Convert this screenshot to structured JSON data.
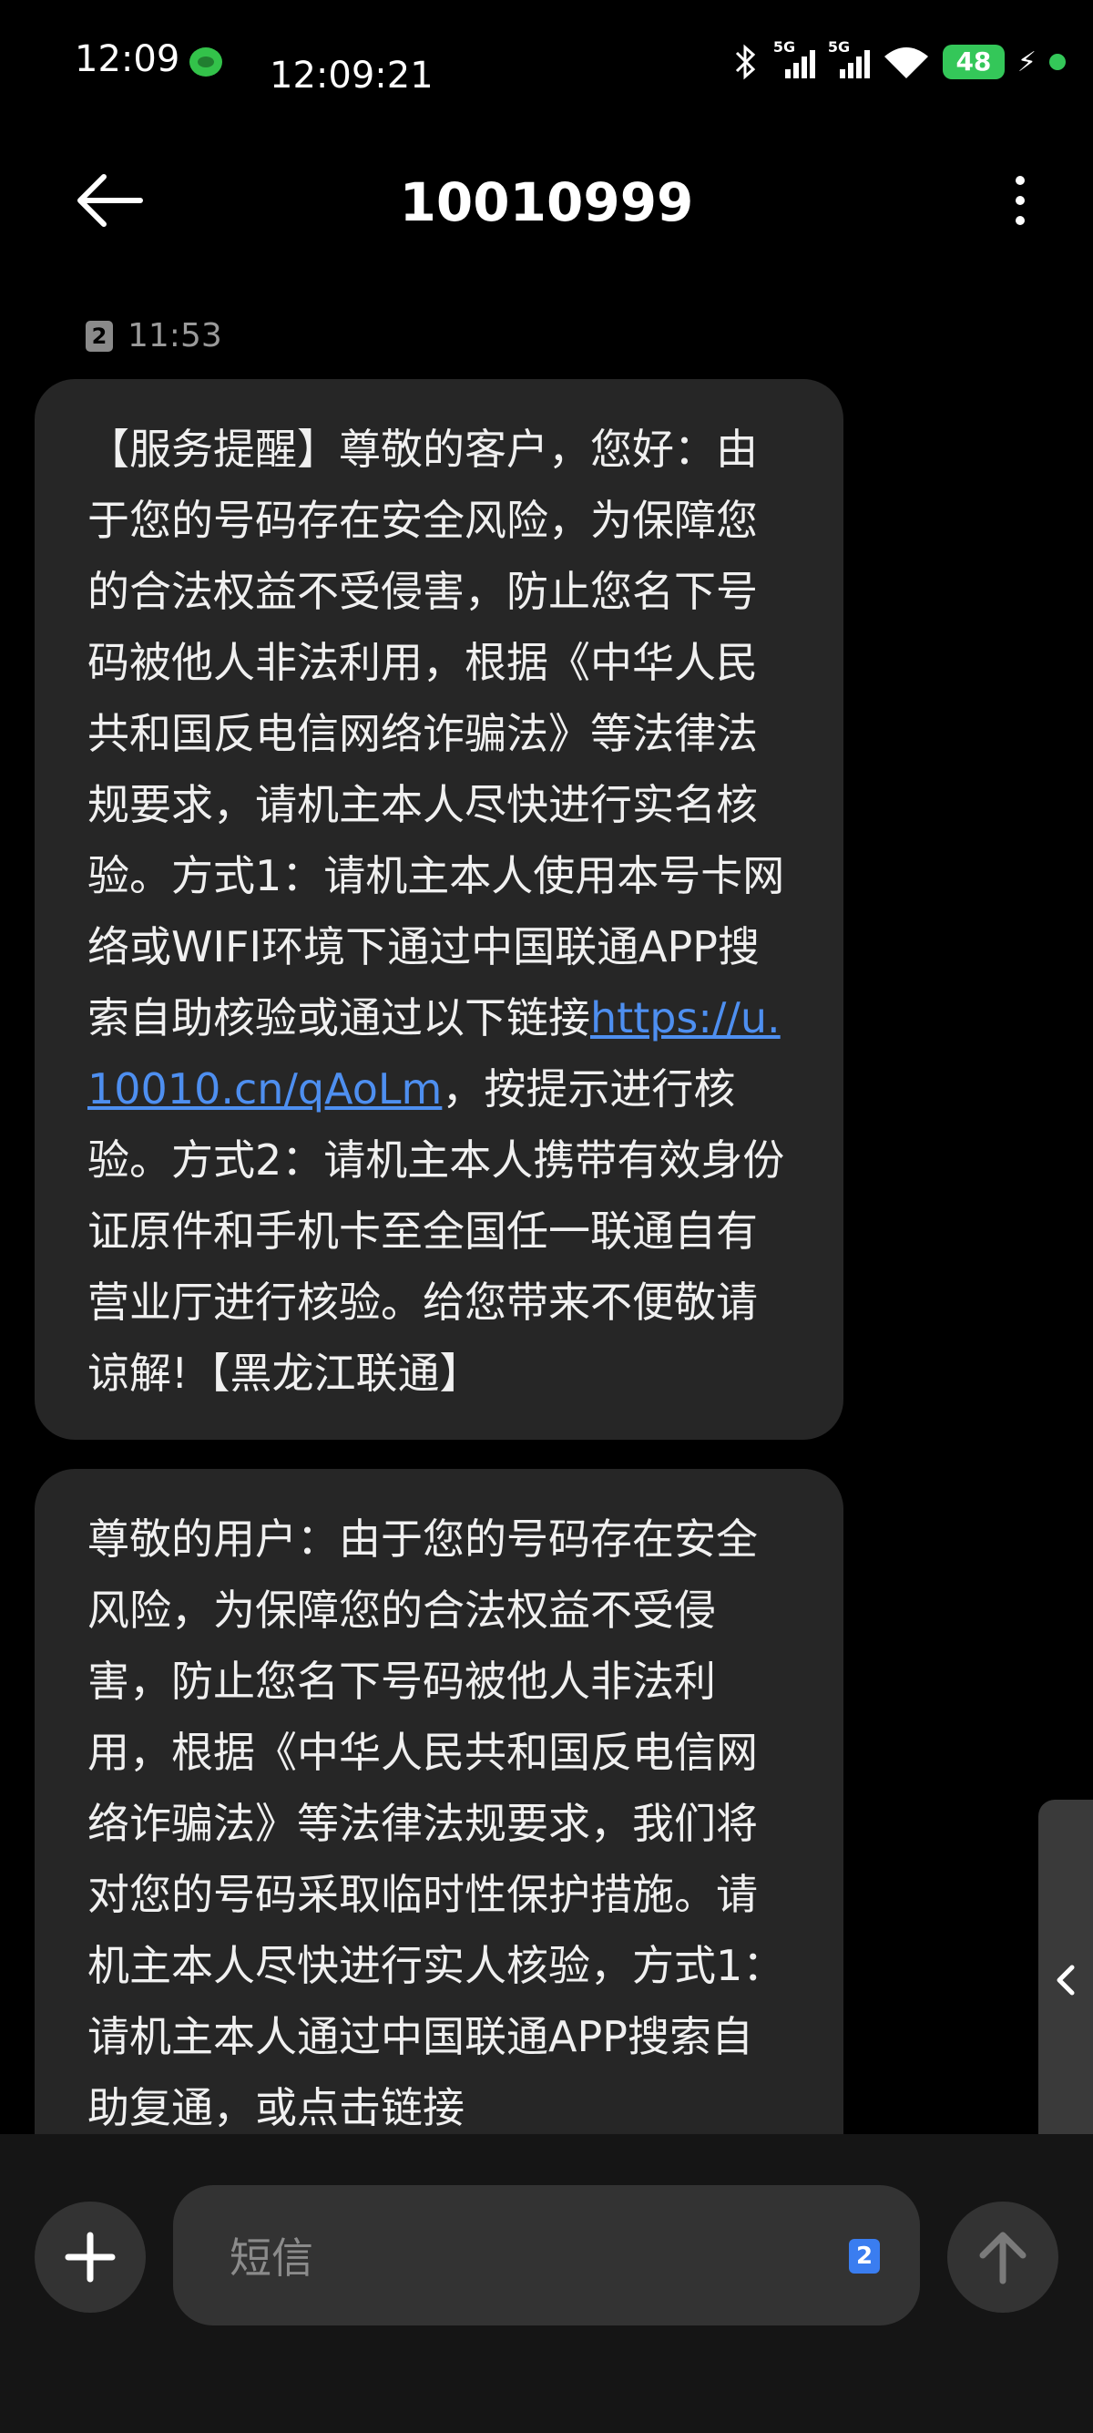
{
  "status_bar": {
    "time": "12:09",
    "time_overlay": "12:09:21",
    "signal1_label": "5G",
    "signal2_label": "5G",
    "battery": "48",
    "battery_color": "#34c759",
    "icons": [
      "wechat-icon",
      "bluetooth-icon",
      "signal-icon",
      "wifi-icon",
      "battery-icon",
      "charging-icon"
    ]
  },
  "header": {
    "title": "10010999",
    "back_icon": "arrow-left-icon",
    "more_icon": "more-vertical-icon"
  },
  "conversation": {
    "sim_badge": "2",
    "timestamp": "11:53",
    "messages": [
      {
        "text_before_link": "【服务提醒】尊敬的客户，您好：由于您的号码存在安全风险，为保障您的合法权益不受侵害，防止您名下号码被他人非法利用，根据《中华人民共和国反电信网络诈骗法》等法律法规要求，请机主本人尽快进行实名核验。方式1：请机主本人使用本号卡网络或WIFI环境下通过中国联通APP搜索自助核验或通过以下链接",
        "link": "https://u.10010.cn/qAoLm",
        "text_after_link": "，按提示进行核验。方式2：请机主本人携带有效身份证原件和手机卡至全国任一联通自有营业厅进行核验。给您带来不便敬请谅解!【黑龙江联通】"
      },
      {
        "text": "尊敬的用户：由于您的号码存在安全风险，为保障您的合法权益不受侵害，防止您名下号码被他人非法利用，根据《中华人民共和国反电信网络诈骗法》等法律法规要求，我们将对您的号码采取临时性保护措施。请机主本人尽快进行实人核验，方式1：请机主本人通过中国联通APP搜索自助复通，或点击链接"
      }
    ]
  },
  "side_tab": {
    "icon": "chevron-left-icon"
  },
  "composer": {
    "placeholder": "短信",
    "sim_badge": "2",
    "add_icon": "plus-icon",
    "send_icon": "arrow-up-icon",
    "sim_color": "#3a7df0"
  }
}
